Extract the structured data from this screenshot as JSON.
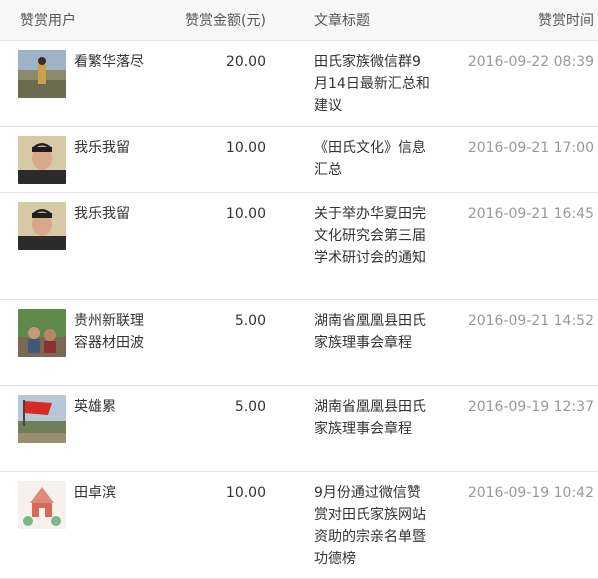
{
  "columns": {
    "user": "赞赏用户",
    "amount": "赞赏金额(元)",
    "title": "文章标题",
    "time": "赞赏时间"
  },
  "rows": [
    {
      "user": "看繁华落尽",
      "avatar": "landscape-person-avatar",
      "amount": "20.00",
      "title": "田氏家族微信群9月14日最新汇总和建议",
      "time": "2016-09-22 08:39"
    },
    {
      "user": "我乐我留",
      "avatar": "man-portrait-avatar",
      "amount": "10.00",
      "title": "《田氏文化》信息汇总",
      "time": "2016-09-21 17:00"
    },
    {
      "user": "我乐我留",
      "avatar": "man-portrait-avatar",
      "amount": "10.00",
      "title": "关于举办华夏田完文化研究会第三届学术研讨会的通知",
      "time": "2016-09-21 16:45"
    },
    {
      "user": "贵州新联理容器材田波",
      "avatar": "outdoor-group-avatar",
      "amount": "5.00",
      "title": "湖南省凰凰县田氏家族理事会章程",
      "time": "2016-09-21 14:52"
    },
    {
      "user": "英雄累",
      "avatar": "red-flag-avatar",
      "amount": "5.00",
      "title": "湖南省凰凰县田氏家族理事会章程",
      "time": "2016-09-19 12:37"
    },
    {
      "user": "田卓滨",
      "avatar": "temple-illustration-avatar",
      "amount": "10.00",
      "title": "9月份通过微信赞赏对田氏家族网站资助的宗亲名单暨功德榜",
      "time": "2016-09-19 10:42"
    }
  ]
}
